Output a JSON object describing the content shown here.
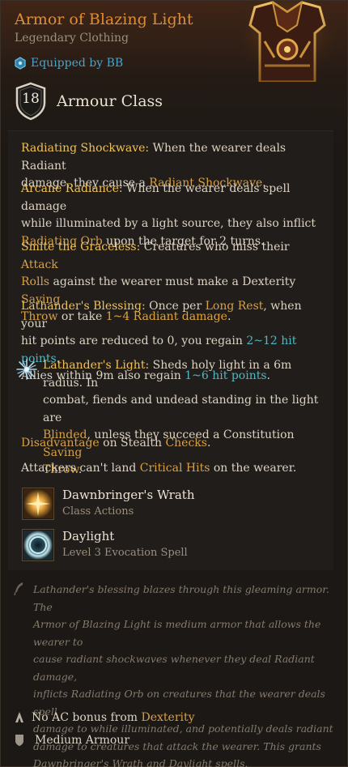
{
  "item": {
    "name": "Armor of Blazing Light",
    "rarity_type": "Legendary Clothing",
    "equipped_by": "Equipped by BB",
    "armour_class_value": "18",
    "armour_class_label": "Armour Class"
  },
  "properties": {
    "radiating_shockwave": {
      "title": "Radiating Shockwave:",
      "line1_rest": " When the wearer deals Radiant",
      "line2_pre": "damage, they cause a ",
      "line2_kw": "Radiant Shockwave",
      "line2_post": "."
    },
    "arcane_radiance": {
      "title": "Arcane Radiance:",
      "line1_rest": " When the wearer deals spell damage",
      "line2": "while illuminated by a light source, they also inflict",
      "line3_kw": "Radiating Orb",
      "line3_post": " upon the target for 2 turns."
    },
    "smite": {
      "title": "Smite the Graceless:",
      "line1_mid": " Creatures who miss their ",
      "line1_kw": "Attack",
      "line2_kw": "Rolls",
      "line2_mid": " against the wearer must make a Dexterity ",
      "line2_kw2": "Saving",
      "line3_kw": "Throw",
      "line3_mid": " or take ",
      "line3_dmg": "1~4 Radiant damage",
      "line3_post": "."
    },
    "blessing": {
      "title": "Lathander's Blessing:",
      "line1_mid": " Once per ",
      "line1_kw": "Long Rest",
      "line1_post": ", when your",
      "line2_pre": "hit points are reduced to 0, you regain ",
      "line2_hp": "2~12 hit points",
      "line2_post": ".",
      "line3_pre": "Allies within 9m also regain ",
      "line3_hp": "1~6 hit points",
      "line3_post": "."
    },
    "light": {
      "title": "Lathander's Light:",
      "line1_rest": " Sheds holy light in a 6m radius. In",
      "line2": "combat, fiends and undead standing in the light are",
      "line3_kw": "Blinded",
      "line3_mid": ", unless they succeed a Constitution ",
      "line3_kw2": "Saving",
      "line4_kw": "Throw",
      "line4_post": "."
    },
    "disadvantage": {
      "kw1": "Disadvantage",
      "mid": " on Stealth ",
      "kw2": "Checks",
      "post": "."
    },
    "critical": {
      "pre": "Attackers can't land ",
      "kw": "Critical Hits",
      "post": " on the wearer."
    }
  },
  "spells": [
    {
      "name": "Dawnbringer's Wrath",
      "type": "Class Actions",
      "icon": "dawnbringer-wrath-icon"
    },
    {
      "name": "Daylight",
      "type": "Level 3 Evocation Spell",
      "icon": "daylight-icon"
    }
  ],
  "lore": {
    "lines": [
      "Lathander's blessing blazes through this gleaming armor. The",
      "Armor of Blazing Light is medium armor that allows the wearer to",
      "cause radiant shockwaves whenever they deal Radiant damage,",
      "inflicts Radiating Orb on creatures that the wearer deals spell",
      "damage to while illuminated, and potentially deals radiant",
      "damage to creatures that attack the wearer. This grants",
      "Dawnbringer's Wrath and Daylight spells."
    ]
  },
  "footer": {
    "dex_pre": "No AC bonus from ",
    "dex_kw": "Dexterity",
    "armour_type": "Medium Armour"
  },
  "colors": {
    "title": "#e38c2c",
    "keyword": "#d6a048",
    "hit_points": "#4fb8c4",
    "equipped": "#4ba2c8"
  }
}
